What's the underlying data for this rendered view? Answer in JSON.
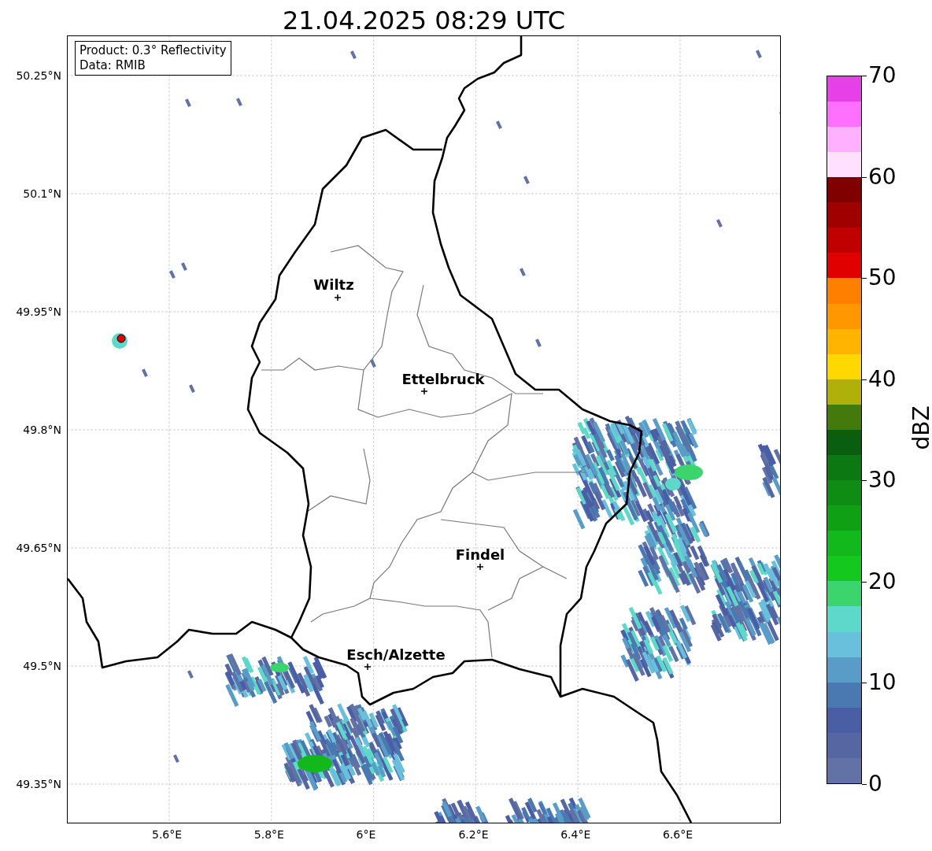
{
  "title": "21.04.2025 08:29 UTC",
  "legend": [
    "Product: 0.3° Reflectivity",
    "Data: RMIB"
  ],
  "cities": [
    {
      "name": "Wiltz"
    },
    {
      "name": "Ettelbruck"
    },
    {
      "name": "Findel"
    },
    {
      "name": "Esch/Alzette"
    }
  ],
  "x_axis": {
    "ticks": [
      "5.6°E",
      "5.8°E",
      "6°E",
      "6.2°E",
      "6.4°E",
      "6.6°E"
    ]
  },
  "y_axis": {
    "ticks": [
      "50.25°N",
      "50.1°N",
      "49.95°N",
      "49.8°N",
      "49.65°N",
      "49.5°N",
      "49.35°N"
    ]
  },
  "colorbar": {
    "label": "dBZ",
    "ticks": [
      "70",
      "60",
      "50",
      "40",
      "30",
      "20",
      "10",
      "0"
    ],
    "segments": [
      {
        "color": "#6272a6"
      },
      {
        "color": "#5566a2"
      },
      {
        "color": "#4a5ea6"
      },
      {
        "color": "#4a78b0"
      },
      {
        "color": "#5a9cc8"
      },
      {
        "color": "#68c0dc"
      },
      {
        "color": "#5ed8c8"
      },
      {
        "color": "#3cd46c"
      },
      {
        "color": "#14c81e"
      },
      {
        "color": "#12b81c"
      },
      {
        "color": "#10a014"
      },
      {
        "color": "#0e8c14"
      },
      {
        "color": "#0b7812"
      },
      {
        "color": "#0a5e10"
      },
      {
        "color": "#447a0c"
      },
      {
        "color": "#b0b00a"
      },
      {
        "color": "#ffd800"
      },
      {
        "color": "#ffb400"
      },
      {
        "color": "#ff9800"
      },
      {
        "color": "#ff8000"
      },
      {
        "color": "#e00000"
      },
      {
        "color": "#c00000"
      },
      {
        "color": "#a00000"
      },
      {
        "color": "#800000"
      },
      {
        "color": "#ffe0ff"
      },
      {
        "color": "#ffb0ff"
      },
      {
        "color": "#ff70ff"
      },
      {
        "color": "#e840e8"
      }
    ]
  }
}
